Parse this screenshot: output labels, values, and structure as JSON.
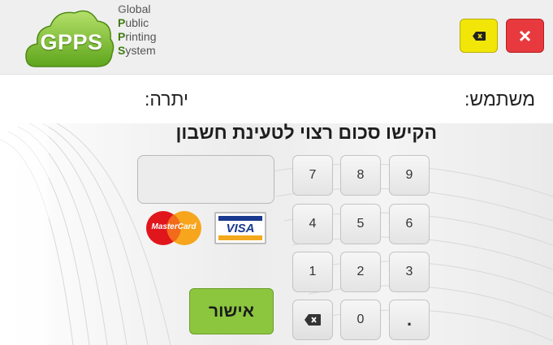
{
  "header": {
    "logo_text": "GPPS",
    "brand_lines": [
      {
        "initial": "G",
        "rest": "lobal"
      },
      {
        "initial": "P",
        "rest": "ublic"
      },
      {
        "initial": "P",
        "rest": "rinting"
      },
      {
        "initial": "S",
        "rest": "ystem"
      }
    ],
    "backspace_icon": "backspace-icon",
    "close_label": "×"
  },
  "user_row": {
    "user_label": "משתמש:",
    "balance_label": "יתרה:"
  },
  "main": {
    "instruction": "הקישו סכום רצוי לטעינת חשבון",
    "amount_value": "",
    "cards": {
      "mastercard": "MasterCard",
      "visa": "VISA"
    },
    "confirm_label": "אישור"
  },
  "keypad": {
    "keys": [
      "9",
      "8",
      "7",
      "6",
      "5",
      "4",
      "3",
      "2",
      "1",
      ".",
      "0",
      "⌫"
    ]
  },
  "colors": {
    "brand_green": "#8cc63f",
    "yellow_button": "#f2e609",
    "red_button": "#e83a3e",
    "confirm_green": "#8cc63f"
  }
}
